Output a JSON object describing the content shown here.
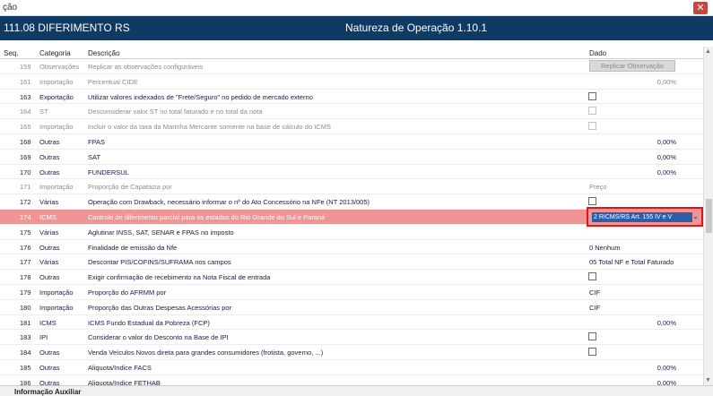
{
  "window": {
    "title": "ção",
    "close_glyph": "✕"
  },
  "header": {
    "code": "111.08  DIFERIMENTO RS",
    "natureza": "Natureza de Operação 1.10.1"
  },
  "columns": {
    "seq": "Seq.",
    "categoria": "Categoria",
    "descricao": "Descrição",
    "dado": "Dado"
  },
  "rows": [
    {
      "seq": "159",
      "cat": "Observações",
      "desc": "Replicar as observações configuráveis",
      "type": "button",
      "value": "Replicar Observação",
      "disabled": true
    },
    {
      "seq": "161",
      "cat": "Importação",
      "desc": "Percentual CIDE",
      "type": "number",
      "value": "0,00%",
      "disabled": true
    },
    {
      "seq": "163",
      "cat": "Exportação",
      "desc": "Utilizar valores indexados de \"Frete/Seguro\" no pedido de mercado externo",
      "type": "checkbox",
      "value": "",
      "disabled": false
    },
    {
      "seq": "164",
      "cat": "ST",
      "desc": "Desconsiderar valor ST no total faturado e no total da nota",
      "type": "checkbox",
      "value": "",
      "disabled": true
    },
    {
      "seq": "165",
      "cat": "Importação",
      "desc": "Incluir o valor da taxa da Marinha Mercante somente na base de cálculo do ICMS",
      "type": "checkbox",
      "value": "",
      "disabled": true
    },
    {
      "seq": "168",
      "cat": "Outras",
      "desc": "FPAS",
      "type": "number",
      "value": "0,00%",
      "disabled": false
    },
    {
      "seq": "169",
      "cat": "Outras",
      "desc": "SAT",
      "type": "number",
      "value": "0,00%",
      "disabled": false
    },
    {
      "seq": "170",
      "cat": "Outras",
      "desc": "FUNDERSUL",
      "type": "number",
      "value": "0,00%",
      "disabled": false
    },
    {
      "seq": "171",
      "cat": "Importação",
      "desc": "Proporção de Capatazia por",
      "type": "text",
      "value": "Preço",
      "disabled": true
    },
    {
      "seq": "172",
      "cat": "Várias",
      "desc": "Operação com Drawback, necessário informar o nº do Ato Concessório na NFe (NT 2013/005)",
      "type": "checkbox",
      "value": "",
      "disabled": false
    },
    {
      "seq": "174",
      "cat": "ICMS",
      "desc": "Controle de diferimento parcial para os estados do Rio Grande do Sul e Paraná",
      "type": "combo",
      "value": "2 RICMS/RS Art. 155 IV e V",
      "disabled": false,
      "selected": true
    },
    {
      "seq": "175",
      "cat": "Várias",
      "desc": "Aglutinar INSS, SAT, SENAR e FPAS no imposto",
      "type": "none",
      "value": "",
      "disabled": false
    },
    {
      "seq": "176",
      "cat": "Outras",
      "desc": "Finalidade de emissão da Nfe",
      "type": "text",
      "value": "0  Nenhum",
      "disabled": false
    },
    {
      "seq": "177",
      "cat": "Várias",
      "desc": "Descontar PIS/COFINS/SUFRAMA nos campos",
      "type": "text",
      "value": "05 Total NF e Total Faturado",
      "disabled": false
    },
    {
      "seq": "178",
      "cat": "Outras",
      "desc": "Exigir confirmação de recebimento na Nota Fiscal de entrada",
      "type": "checkbox",
      "value": "",
      "disabled": false
    },
    {
      "seq": "179",
      "cat": "Importação",
      "desc": "Proporção do AFRMM por",
      "type": "text",
      "value": "CIF",
      "disabled": false
    },
    {
      "seq": "180",
      "cat": "Importação",
      "desc": "Proporção das Outras Despesas Acessórias por",
      "type": "text",
      "value": "CIF",
      "disabled": false
    },
    {
      "seq": "181",
      "cat": "ICMS",
      "desc": "ICMS Fundo Estadual da Pobreza (FCP)",
      "type": "number",
      "value": "0,00%",
      "disabled": false
    },
    {
      "seq": "183",
      "cat": "IPI",
      "desc": "Considerar o valor do Desconto na Base de IPI",
      "type": "checkbox",
      "value": "",
      "disabled": false
    },
    {
      "seq": "184",
      "cat": "Outras",
      "desc": "Venda Veículos Novos direta para grandes consumidores (frotista, governo, ...)",
      "type": "checkbox",
      "value": "",
      "disabled": false
    },
    {
      "seq": "185",
      "cat": "Outras",
      "desc": "Aliquota/Indice FACS",
      "type": "number",
      "value": "0,00%",
      "disabled": false
    },
    {
      "seq": "186",
      "cat": "Outras",
      "desc": "Aliquota/Indice FETHAB",
      "type": "number",
      "value": "0,00%",
      "disabled": false
    }
  ],
  "footer": {
    "label": "Informação Auxiliar"
  },
  "colors": {
    "header_bg": "#0f3a63",
    "selected_row": "#f09595",
    "highlight_border": "#e01616",
    "combo_bg": "#2f5ea8"
  }
}
